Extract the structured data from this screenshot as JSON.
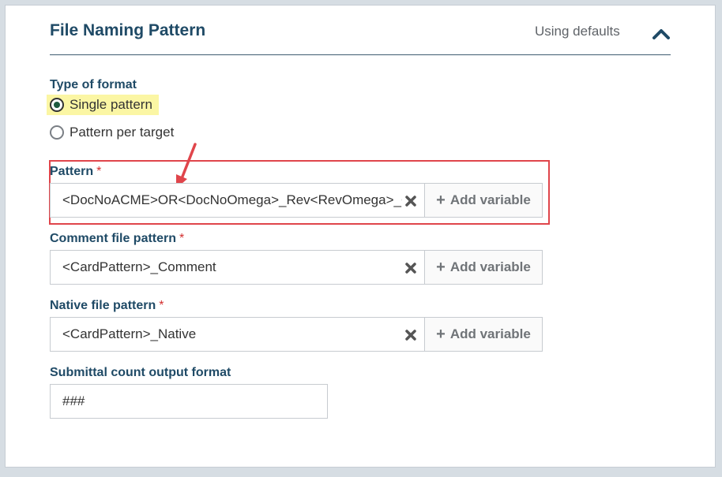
{
  "header": {
    "title": "File Naming Pattern",
    "status": "Using defaults"
  },
  "format": {
    "label": "Type of format",
    "options": [
      {
        "label": "Single pattern",
        "selected": true
      },
      {
        "label": "Pattern per target",
        "selected": false
      }
    ]
  },
  "pattern": {
    "label": "Pattern",
    "required_mark": "*",
    "value": "<DocNoACME>OR<DocNoOmega>_Rev<RevOmega>_<",
    "add_label": "Add variable"
  },
  "comment_pattern": {
    "label": "Comment file pattern",
    "required_mark": "*",
    "value": "<CardPattern>_Comment",
    "add_label": "Add variable"
  },
  "native_pattern": {
    "label": "Native file pattern",
    "required_mark": "*",
    "value": "<CardPattern>_Native",
    "add_label": "Add variable"
  },
  "submittal_count": {
    "label": "Submittal count output format",
    "value": "###"
  },
  "colors": {
    "title": "#1f4a66",
    "highlight": "#fbf6a4",
    "annotation": "#e0454b"
  }
}
